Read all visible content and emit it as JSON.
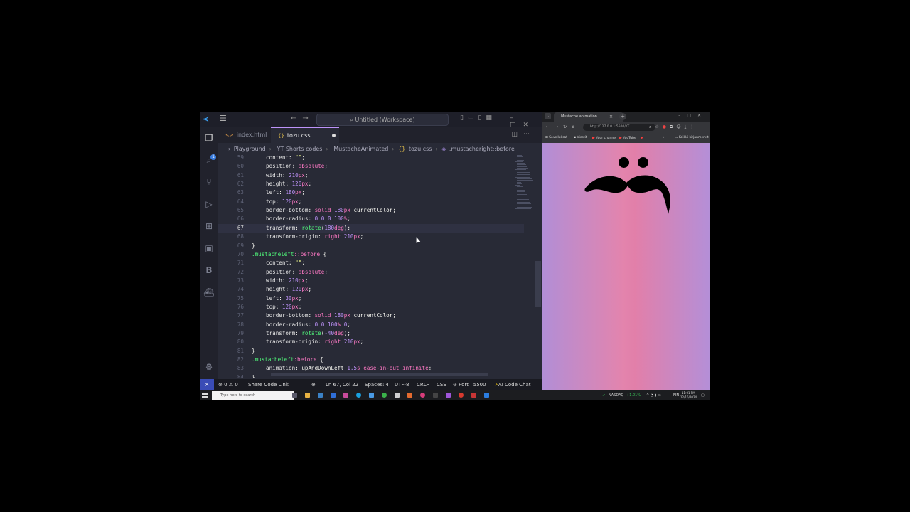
{
  "vscode": {
    "title": "Untitled (Workspace)",
    "tabs": [
      {
        "label": "index.html",
        "active": false
      },
      {
        "label": "tozu.css",
        "active": true,
        "modified": true
      }
    ],
    "breadcrumb": [
      "Playground",
      "YT Shorts codes",
      "MustacheAnimated",
      "tozu.css",
      ".mustacheright::before"
    ],
    "activity_badge": "1",
    "activity_letter": "B",
    "code_lines": [
      {
        "n": "59",
        "tokens": [
          [
            "p",
            "content"
          ],
          [
            "v-plain",
            ": "
          ],
          [
            "v-str",
            "\"\""
          ],
          [
            "v-plain",
            ";"
          ]
        ],
        "indent": 1
      },
      {
        "n": "60",
        "tokens": [
          [
            "p",
            "position"
          ],
          [
            "v-plain",
            ": "
          ],
          [
            "v-kw",
            "absolute"
          ],
          [
            "v-plain",
            ";"
          ]
        ],
        "indent": 1
      },
      {
        "n": "61",
        "tokens": [
          [
            "p",
            "width"
          ],
          [
            "v-plain",
            ": "
          ],
          [
            "v-num",
            "210"
          ],
          [
            "v-kw",
            "px"
          ],
          [
            "v-plain",
            ";"
          ]
        ],
        "indent": 1
      },
      {
        "n": "62",
        "tokens": [
          [
            "p",
            "height"
          ],
          [
            "v-plain",
            ": "
          ],
          [
            "v-num",
            "120"
          ],
          [
            "v-kw",
            "px"
          ],
          [
            "v-plain",
            ";"
          ]
        ],
        "indent": 1
      },
      {
        "n": "63",
        "tokens": [
          [
            "p",
            "left"
          ],
          [
            "v-plain",
            ": "
          ],
          [
            "v-num",
            "180"
          ],
          [
            "v-kw",
            "px"
          ],
          [
            "v-plain",
            ";"
          ]
        ],
        "indent": 1
      },
      {
        "n": "64",
        "tokens": [
          [
            "p",
            "top"
          ],
          [
            "v-plain",
            ": "
          ],
          [
            "v-num",
            "120"
          ],
          [
            "v-kw",
            "px"
          ],
          [
            "v-plain",
            ";"
          ]
        ],
        "indent": 1
      },
      {
        "n": "65",
        "tokens": [
          [
            "p",
            "border-bottom"
          ],
          [
            "v-plain",
            ": "
          ],
          [
            "v-kw",
            "solid "
          ],
          [
            "v-num",
            "180"
          ],
          [
            "v-kw",
            "px "
          ],
          [
            "v-plain",
            "currentColor;"
          ]
        ],
        "indent": 1
      },
      {
        "n": "66",
        "tokens": [
          [
            "p",
            "border-radius"
          ],
          [
            "v-plain",
            ": "
          ],
          [
            "v-num",
            "0 0 0 100"
          ],
          [
            "v-kw",
            "%"
          ],
          [
            "v-plain",
            ";"
          ]
        ],
        "indent": 1
      },
      {
        "n": "67",
        "tokens": [
          [
            "p",
            "transform"
          ],
          [
            "v-plain",
            ": "
          ],
          [
            "v-fn",
            "rotate"
          ],
          [
            "v-plain",
            "("
          ],
          [
            "v-num",
            "180"
          ],
          [
            "v-kw",
            "deg"
          ],
          [
            "v-plain",
            ");"
          ]
        ],
        "indent": 1,
        "current": true
      },
      {
        "n": "68",
        "tokens": [
          [
            "p",
            "transform-origin"
          ],
          [
            "v-plain",
            ": "
          ],
          [
            "v-kw",
            "right "
          ],
          [
            "v-num",
            "210"
          ],
          [
            "v-kw",
            "px"
          ],
          [
            "v-plain",
            ";"
          ]
        ],
        "indent": 1
      },
      {
        "n": "69",
        "tokens": [
          [
            "v-plain",
            "}"
          ]
        ],
        "indent": 0
      },
      {
        "n": "70",
        "tokens": [
          [
            "v-sel",
            ".mustacheleft"
          ],
          [
            "v-kw",
            "::before"
          ],
          [
            "v-plain",
            " {"
          ]
        ],
        "indent": 0
      },
      {
        "n": "71",
        "tokens": [
          [
            "p",
            "content"
          ],
          [
            "v-plain",
            ": "
          ],
          [
            "v-str",
            "\"\""
          ],
          [
            "v-plain",
            ";"
          ]
        ],
        "indent": 1
      },
      {
        "n": "72",
        "tokens": [
          [
            "p",
            "position"
          ],
          [
            "v-plain",
            ": "
          ],
          [
            "v-kw",
            "absolute"
          ],
          [
            "v-plain",
            ";"
          ]
        ],
        "indent": 1
      },
      {
        "n": "73",
        "tokens": [
          [
            "p",
            "width"
          ],
          [
            "v-plain",
            ": "
          ],
          [
            "v-num",
            "210"
          ],
          [
            "v-kw",
            "px"
          ],
          [
            "v-plain",
            ";"
          ]
        ],
        "indent": 1
      },
      {
        "n": "74",
        "tokens": [
          [
            "p",
            "height"
          ],
          [
            "v-plain",
            ": "
          ],
          [
            "v-num",
            "120"
          ],
          [
            "v-kw",
            "px"
          ],
          [
            "v-plain",
            ";"
          ]
        ],
        "indent": 1
      },
      {
        "n": "75",
        "tokens": [
          [
            "p",
            "left"
          ],
          [
            "v-plain",
            ": "
          ],
          [
            "v-num",
            "30"
          ],
          [
            "v-kw",
            "px"
          ],
          [
            "v-plain",
            ";"
          ]
        ],
        "indent": 1
      },
      {
        "n": "76",
        "tokens": [
          [
            "p",
            "top"
          ],
          [
            "v-plain",
            ": "
          ],
          [
            "v-num",
            "120"
          ],
          [
            "v-kw",
            "px"
          ],
          [
            "v-plain",
            ";"
          ]
        ],
        "indent": 1
      },
      {
        "n": "77",
        "tokens": [
          [
            "p",
            "border-bottom"
          ],
          [
            "v-plain",
            ": "
          ],
          [
            "v-kw",
            "solid "
          ],
          [
            "v-num",
            "180"
          ],
          [
            "v-kw",
            "px "
          ],
          [
            "v-plain",
            "currentColor;"
          ]
        ],
        "indent": 1
      },
      {
        "n": "78",
        "tokens": [
          [
            "p",
            "border-radius"
          ],
          [
            "v-plain",
            ": "
          ],
          [
            "v-num",
            "0 0 100"
          ],
          [
            "v-kw",
            "% "
          ],
          [
            "v-num",
            "0"
          ],
          [
            "v-plain",
            ";"
          ]
        ],
        "indent": 1
      },
      {
        "n": "79",
        "tokens": [
          [
            "p",
            "transform"
          ],
          [
            "v-plain",
            ": "
          ],
          [
            "v-fn",
            "rotate"
          ],
          [
            "v-plain",
            "("
          ],
          [
            "v-num",
            "-40"
          ],
          [
            "v-kw",
            "deg"
          ],
          [
            "v-plain",
            ");"
          ]
        ],
        "indent": 1
      },
      {
        "n": "80",
        "tokens": [
          [
            "p",
            "transform-origin"
          ],
          [
            "v-plain",
            ": "
          ],
          [
            "v-kw",
            "right "
          ],
          [
            "v-num",
            "210"
          ],
          [
            "v-kw",
            "px"
          ],
          [
            "v-plain",
            ";"
          ]
        ],
        "indent": 1
      },
      {
        "n": "81",
        "tokens": [
          [
            "v-plain",
            "}"
          ]
        ],
        "indent": 0
      },
      {
        "n": "82",
        "tokens": [
          [
            "v-sel",
            ".mustacheleft"
          ],
          [
            "v-kw",
            ":before"
          ],
          [
            "v-plain",
            " {"
          ]
        ],
        "indent": 0
      },
      {
        "n": "83",
        "tokens": [
          [
            "p",
            "animation"
          ],
          [
            "v-plain",
            ": "
          ],
          [
            "v-plain",
            "upAndDownLeft "
          ],
          [
            "v-num",
            "1.5"
          ],
          [
            "v-kw",
            "s "
          ],
          [
            "v-kw",
            "ease-in-out infinite"
          ],
          [
            "v-plain",
            ";"
          ]
        ],
        "indent": 1
      },
      {
        "n": "84",
        "tokens": [
          [
            "v-plain",
            "}"
          ]
        ],
        "indent": 0
      }
    ],
    "status": {
      "problems_errors": "0",
      "problems_warnings": "0",
      "share": "Share Code Link",
      "position": "Ln 67, Col 22",
      "spaces": "Spaces: 4",
      "encoding": "UTF-8",
      "eol": "CRLF",
      "language": "CSS",
      "port": "Port : 5500",
      "ai": "AI Code Chat"
    }
  },
  "browser": {
    "tab_title": "Mustache animation",
    "url": "http://127.0.0.1:5500/YT...",
    "bookmarks": [
      "Sovelluksat",
      "Viestit",
      "Your channel",
      "YouTube",
      "Kaikki kirjanmerkit"
    ]
  },
  "taskbar": {
    "search_placeholder": "Type here to search",
    "ticker_name": "NASDAQ",
    "ticker_change": "+1.01%",
    "language": "FIN",
    "time": "11:01 PM",
    "date": "12/16/2024"
  },
  "colors": {
    "accent": "#bd93f9",
    "status_remote": "#3a4cb6",
    "viewport_pink": "#e384ad",
    "viewport_purple": "#b28ed6"
  }
}
